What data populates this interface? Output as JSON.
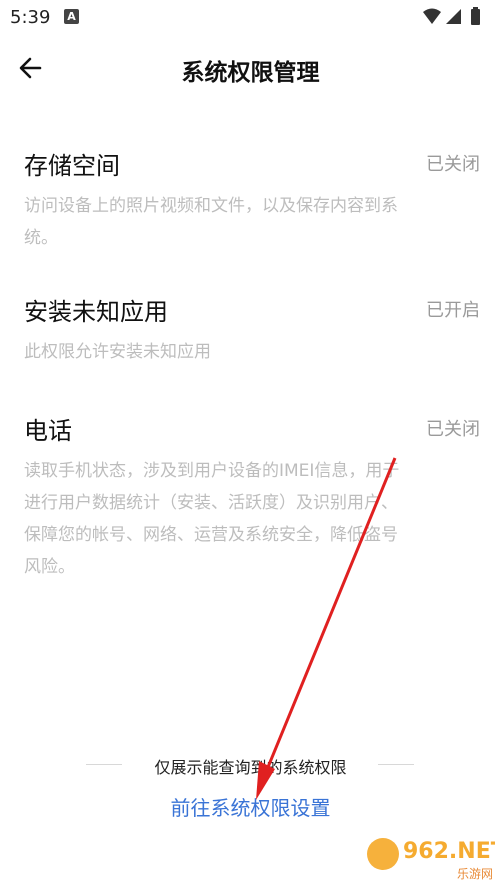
{
  "status_bar": {
    "time": "5:39",
    "notification_badge": "A",
    "icons": [
      "wifi-icon",
      "signal-icon",
      "battery-icon"
    ]
  },
  "header": {
    "back_icon": "arrow-left-icon",
    "title": "系统权限管理"
  },
  "permissions": [
    {
      "name": "存储空间",
      "status": "已关闭",
      "description": "访问设备上的照片视频和文件，以及保存内容到系统。"
    },
    {
      "name": "安装未知应用",
      "status": "已开启",
      "description": "此权限允许安装未知应用"
    },
    {
      "name": "电话",
      "status": "已关闭",
      "description": "读取手机状态，涉及到用户设备的IMEI信息，用于进行用户数据统计（安装、活跃度）及识别用户、保障您的帐号、网络、运营及系统安全，降低盗号风险。"
    }
  ],
  "footer": {
    "note": "仅展示能查询到的系统权限",
    "link": "前往系统权限设置"
  },
  "watermark": {
    "brand": "962.NET",
    "sub": "乐游网"
  },
  "colors": {
    "link": "#3a74d6",
    "status_gray": "#9a9a9a",
    "desc_gray": "#bdbdbd",
    "annotation_arrow": "#e02020"
  }
}
